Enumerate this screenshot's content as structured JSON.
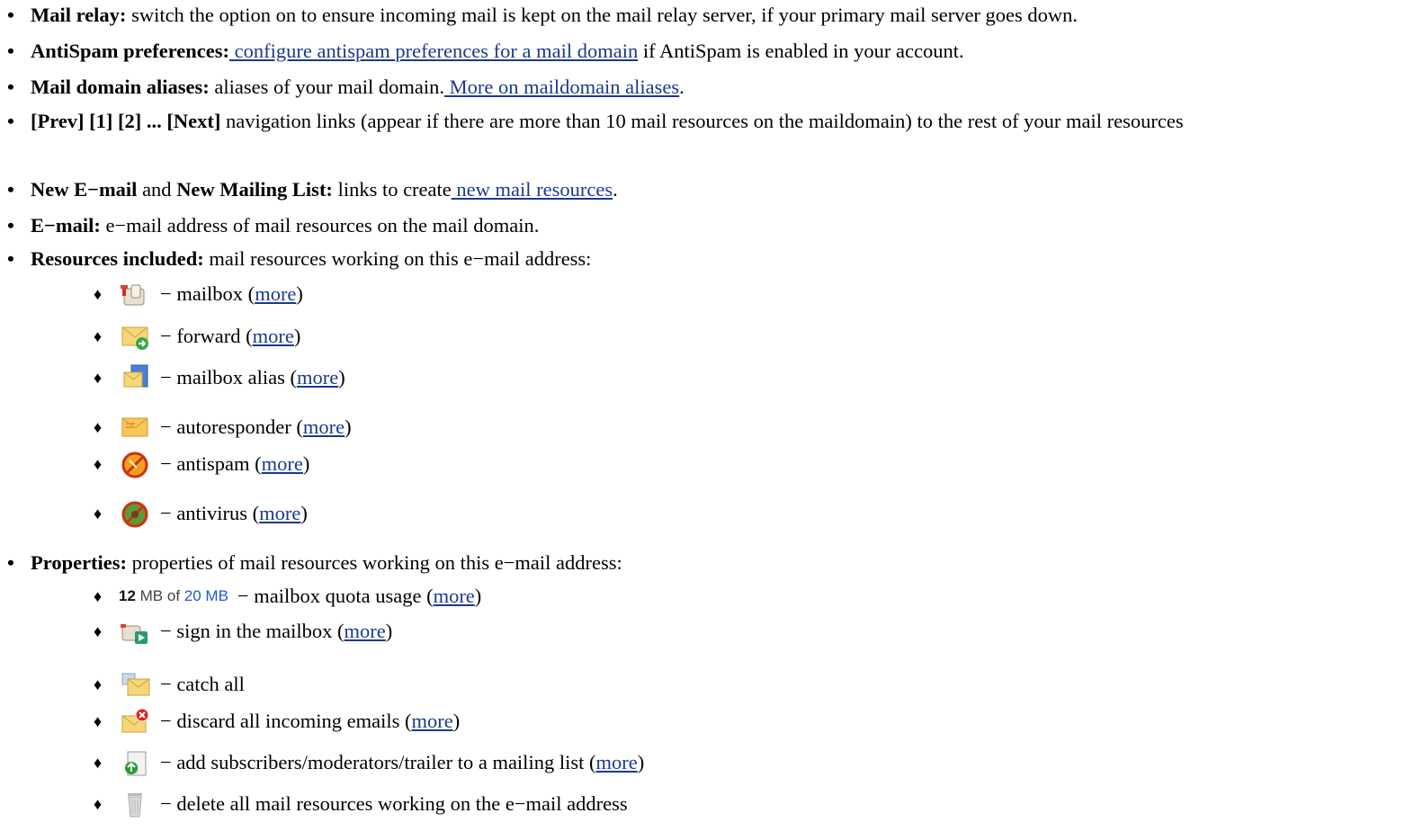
{
  "items": {
    "relay": {
      "term": "Mail relay:",
      "text": " switch the option on to ensure incoming mail is kept on the mail relay server, if your primary mail server goes down."
    },
    "antispam": {
      "term": "AntiSpam preferences:",
      "link": " configure antispam preferences for a mail domain",
      "text": " if AntiSpam is enabled in your account."
    },
    "aliases": {
      "term": "Mail domain aliases:",
      "text": " aliases of your mail domain.",
      "link": " More on maildomain aliases",
      "end": "."
    },
    "nav": {
      "term": "[Prev] [1] [2] ... [Next]",
      "text": " navigation links (appear if there are more than 10 mail resources on the maildomain) to the rest of your mail resources"
    },
    "newmail": {
      "term1": "New E−mail",
      "and": " and ",
      "term2": "New Mailing List:",
      "text": " links to create",
      "link": " new mail resources",
      "end": "."
    },
    "email": {
      "term": "E−mail:",
      "text": " e−mail address of mail resources on the mail domain."
    },
    "resources": {
      "term": "Resources included:",
      "text": " mail resources working on this e−mail address:"
    },
    "properties": {
      "term": "Properties:",
      "text": " properties of mail resources working on this e−mail address:"
    }
  },
  "resources": [
    {
      "icon": "mailbox-icon",
      "text": "− mailbox (",
      "link": "more",
      "end": ")"
    },
    {
      "icon": "forward-icon",
      "text": "− forward (",
      "link": "more",
      "end": ")"
    },
    {
      "icon": "mailbox-alias-icon",
      "text": "− mailbox alias (",
      "link": "more",
      "end": ")"
    },
    {
      "icon": "autoresponder-icon",
      "text": "− autoresponder (",
      "link": "more",
      "end": ")"
    },
    {
      "icon": "antispam-icon",
      "text": "− antispam (",
      "link": "more",
      "end": ")"
    },
    {
      "icon": "antivirus-icon",
      "text": "− antivirus (",
      "link": "more",
      "end": ")"
    }
  ],
  "quota": {
    "used": "12",
    "mid": " MB of ",
    "total": "20 MB"
  },
  "properties": [
    {
      "icon": "quota-icon",
      "text": "− mailbox quota usage (",
      "link": "more",
      "end": ")"
    },
    {
      "icon": "sign-in-mailbox-icon",
      "text": "− sign in the mailbox (",
      "link": "more",
      "end": ")"
    },
    {
      "icon": "catch-all-icon",
      "text": "− catch all",
      "link": "",
      "end": ""
    },
    {
      "icon": "discard-icon",
      "text": "− discard all incoming emails (",
      "link": "more",
      "end": ")"
    },
    {
      "icon": "add-subscribers-icon",
      "text": "− add subscribers/moderators/trailer to a mailing list (",
      "link": "more",
      "end": ")"
    },
    {
      "icon": "trash-icon",
      "text": "− delete all mail resources working on the e−mail address",
      "link": "",
      "end": ""
    }
  ],
  "bullet": "♦"
}
